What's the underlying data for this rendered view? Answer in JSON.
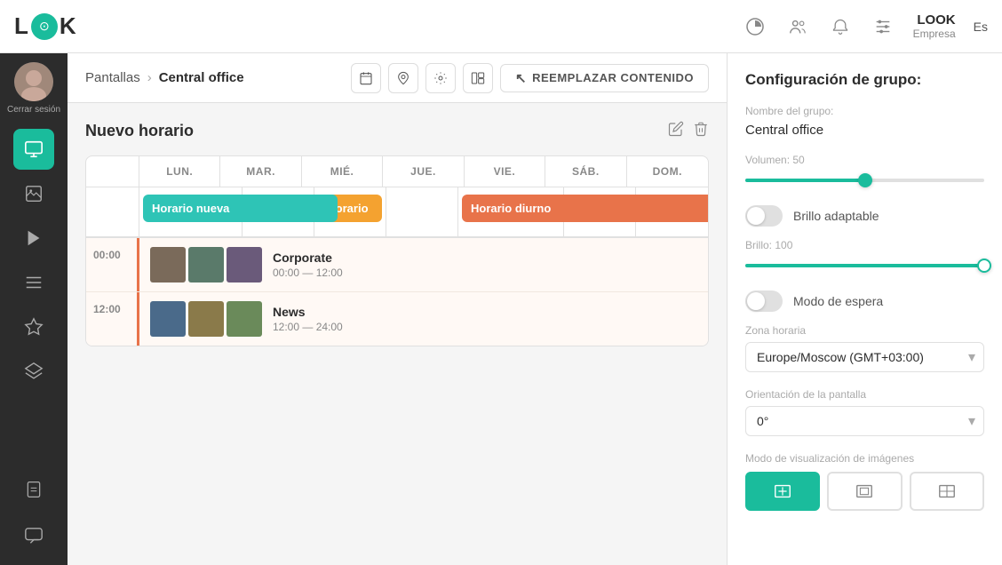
{
  "navbar": {
    "logo_text_left": "L",
    "logo_text_right": "K",
    "logo_icon": "⊙",
    "user_name": "LOOK",
    "user_sub": "Empresa",
    "lang": "Es",
    "icons": [
      "chart-icon",
      "users-icon",
      "bell-icon",
      "settings-icon"
    ]
  },
  "sidebar": {
    "signout_label": "Cerrar sesión",
    "items": [
      {
        "name": "sidebar-item-screen",
        "icon": "▣",
        "active": true
      },
      {
        "name": "sidebar-item-image",
        "icon": "🖼",
        "active": false
      },
      {
        "name": "sidebar-item-video",
        "icon": "▶",
        "active": false
      },
      {
        "name": "sidebar-item-list",
        "icon": "☰",
        "active": false
      },
      {
        "name": "sidebar-item-star",
        "icon": "★",
        "active": false
      },
      {
        "name": "sidebar-item-layers",
        "icon": "⊞",
        "active": false
      },
      {
        "name": "sidebar-item-doc",
        "icon": "📄",
        "active": false
      },
      {
        "name": "sidebar-item-chat",
        "icon": "💬",
        "active": false
      }
    ]
  },
  "header": {
    "breadcrumb_parent": "Pantallas",
    "breadcrumb_current": "Central office",
    "toolbar_buttons": [
      "calendar-icon",
      "location-icon",
      "settings-icon",
      "layout-icon"
    ],
    "replace_btn_label": "REEMPLAZAR CONTENIDO",
    "cursor_icon": "cursor-icon"
  },
  "schedule": {
    "title": "Nuevo horario",
    "days": [
      "LUN.",
      "MAR.",
      "MIÉ.",
      "JUE.",
      "VIE.",
      "SÁB.",
      "DOM."
    ],
    "blocks": [
      {
        "label": "Horario nueva",
        "color": "cyan",
        "col": 0
      },
      {
        "label": "Horario",
        "color": "orange",
        "col": 1
      },
      {
        "label": "Horario diurno",
        "color": "salmon",
        "col_start": 4,
        "col_end": 6
      }
    ],
    "items": [
      {
        "time": "00:00",
        "name": "Corporate",
        "timerange": "00:00 — 12:00"
      },
      {
        "time": "12:00",
        "name": "News",
        "timerange": "12:00 — 24:00"
      }
    ]
  },
  "right_panel": {
    "title": "Configuración de grupo:",
    "group_name_label": "Nombre del grupo:",
    "group_name_value": "Central office",
    "volume_label": "Volumen: 50",
    "volume_pct": 50,
    "brightness_toggle_label": "Brillo adaptable",
    "brightness_label": "Brillo: 100",
    "brightness_pct": 100,
    "standby_label": "Modo de espera",
    "timezone_label": "Zona horaria",
    "timezone_value": "Europe/Moscow (GMT+03:00)",
    "orientation_label": "Orientación de la pantalla",
    "orientation_value": "0°",
    "image_mode_label": "Modo de visualización de imágenes",
    "image_mode_options": [
      {
        "name": "fit-icon",
        "active": true
      },
      {
        "name": "fill-icon",
        "active": false
      },
      {
        "name": "stretch-icon",
        "active": false
      }
    ]
  }
}
